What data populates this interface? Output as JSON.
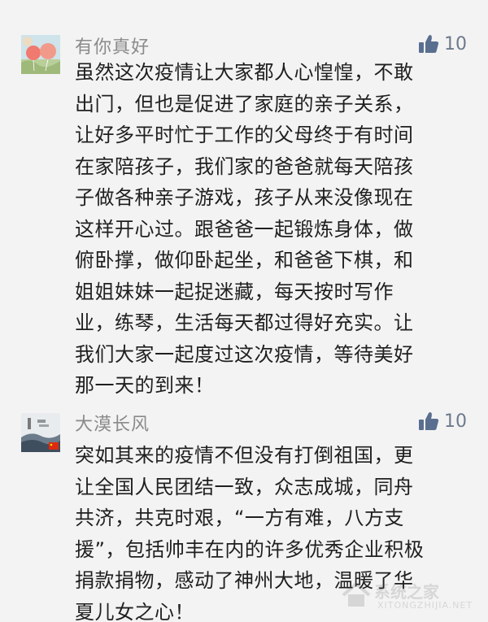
{
  "comments": [
    {
      "username": "有你真好",
      "likes": "10",
      "avatar_icon": "heart-balloons-avatar-icon",
      "text": "虽然这次疫情让大家都人心惶惶，不敢\n出门，但也是促进了家庭的亲子关系，\n让好多平时忙于工作的父母终于有时间\n在家陪孩子，我们家的爸爸就每天陪孩\n子做各种亲子游戏，孩子从来没像现在\n这样开心过。跟爸爸一起锻炼身体，做\n俯卧撑，做仰卧起坐，和爸爸下棋，和\n姐姐妹妹一起捉迷藏，每天按时写作\n业，练琴，生活每天都过得好充实。让\n我们大家一起度过这次疫情，等待美好\n那一天的到来！"
    },
    {
      "username": "大漠长风",
      "likes": "10",
      "avatar_icon": "landscape-flag-avatar-icon",
      "text": "突如其来的疫情不但没有打倒祖国，更\n让全国人民团结一致，众志成城，同舟\n共济，共克时艰，“一方有难，八方支\n援”，包括帅丰在内的许多优秀企业积极\n捐款捐物，感动了神州大地，温暖了华\n夏儿女之心！"
    }
  ],
  "watermark": {
    "text": "系统之家",
    "url": "XITONGZHIJIA.NET"
  },
  "colors": {
    "background": "#f3f3f3",
    "username": "#8a8a8a",
    "like_accent": "#5a6f8f",
    "text": "#1f1f1f"
  }
}
